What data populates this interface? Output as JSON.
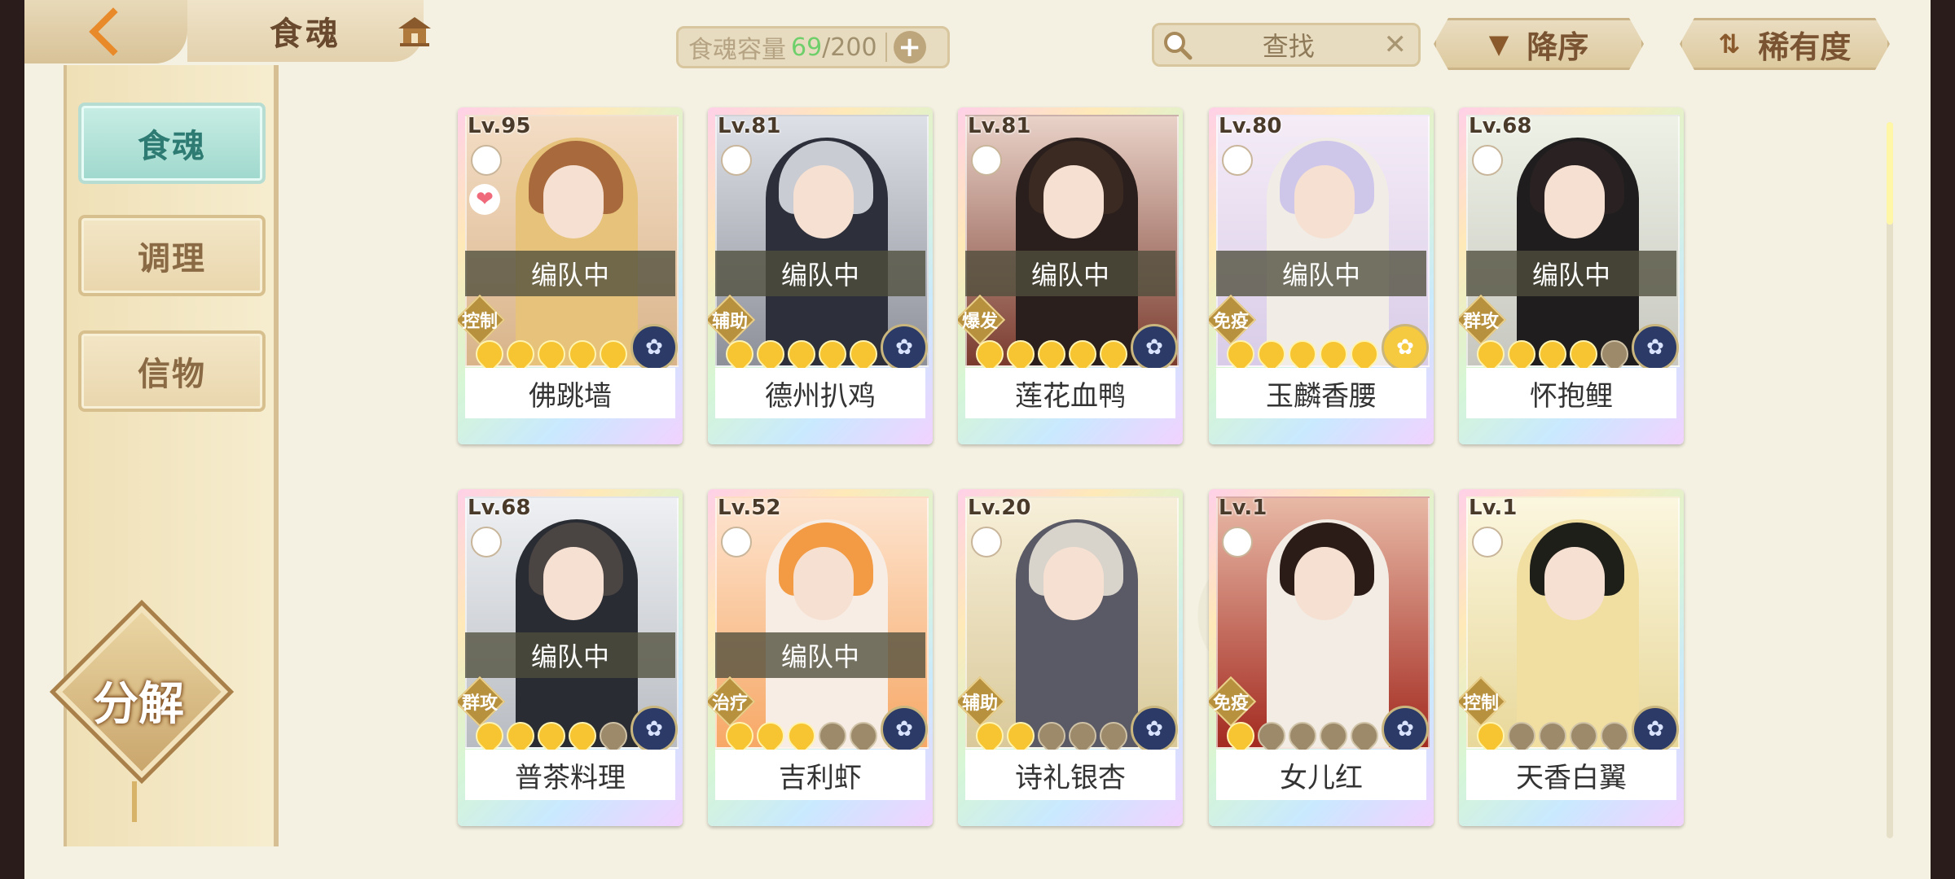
{
  "header": {
    "title": "食魂",
    "capacity_label": "食魂容量",
    "capacity_value": "69",
    "capacity_max": "/200",
    "search_label": "查找",
    "sort_label": "降序",
    "rarity_label": "稀有度",
    "icons": [
      "back-arrow-icon",
      "home-icon",
      "plus-icon",
      "search-icon",
      "close-icon",
      "sort-down-icon",
      "sort-rarity-icon"
    ]
  },
  "sidebar": {
    "tabs": [
      {
        "label": "食魂"
      },
      {
        "label": "调理"
      },
      {
        "label": "信物"
      }
    ],
    "decompose_label": "分解"
  },
  "colors": {
    "accent": "#e88a2a",
    "active_tab": "#9fd8cd",
    "capacity_value": "#6fcf6a"
  },
  "cards": [
    {
      "level": "Lv.95",
      "name": "佛跳墙",
      "team": "编队中",
      "role": "控制",
      "stars_on": 5,
      "stars_total": 5,
      "favorite": true,
      "element": "lotus"
    },
    {
      "level": "Lv.81",
      "name": "德州扒鸡",
      "team": "编队中",
      "role": "辅助",
      "stars_on": 5,
      "stars_total": 5,
      "favorite": false,
      "element": "lotus"
    },
    {
      "level": "Lv.81",
      "name": "莲花血鸭",
      "team": "编队中",
      "role": "爆发",
      "stars_on": 5,
      "stars_total": 5,
      "favorite": false,
      "element": "lotus"
    },
    {
      "level": "Lv.80",
      "name": "玉麟香腰",
      "team": "编队中",
      "role": "免疫",
      "stars_on": 5,
      "stars_total": 5,
      "favorite": false,
      "element": "gold"
    },
    {
      "level": "Lv.68",
      "name": "怀抱鲤",
      "team": "编队中",
      "role": "群攻",
      "stars_on": 4,
      "stars_total": 5,
      "favorite": false,
      "element": "lotus"
    },
    {
      "level": "Lv.68",
      "name": "普茶料理",
      "team": "编队中",
      "role": "群攻",
      "stars_on": 4,
      "stars_total": 5,
      "favorite": false,
      "element": "lotus"
    },
    {
      "level": "Lv.52",
      "name": "吉利虾",
      "team": "编队中",
      "role": "治疗",
      "stars_on": 3,
      "stars_total": 5,
      "favorite": false,
      "element": "lotus"
    },
    {
      "level": "Lv.20",
      "name": "诗礼银杏",
      "team": "",
      "role": "辅助",
      "stars_on": 2,
      "stars_total": 5,
      "favorite": false,
      "element": "lotus"
    },
    {
      "level": "Lv.1",
      "name": "女儿红",
      "team": "",
      "role": "免疫",
      "stars_on": 1,
      "stars_total": 5,
      "favorite": false,
      "element": "lotus"
    },
    {
      "level": "Lv.1",
      "name": "天香白翼",
      "team": "",
      "role": "控制",
      "stars_on": 1,
      "stars_total": 5,
      "favorite": false,
      "element": "lotus"
    }
  ]
}
